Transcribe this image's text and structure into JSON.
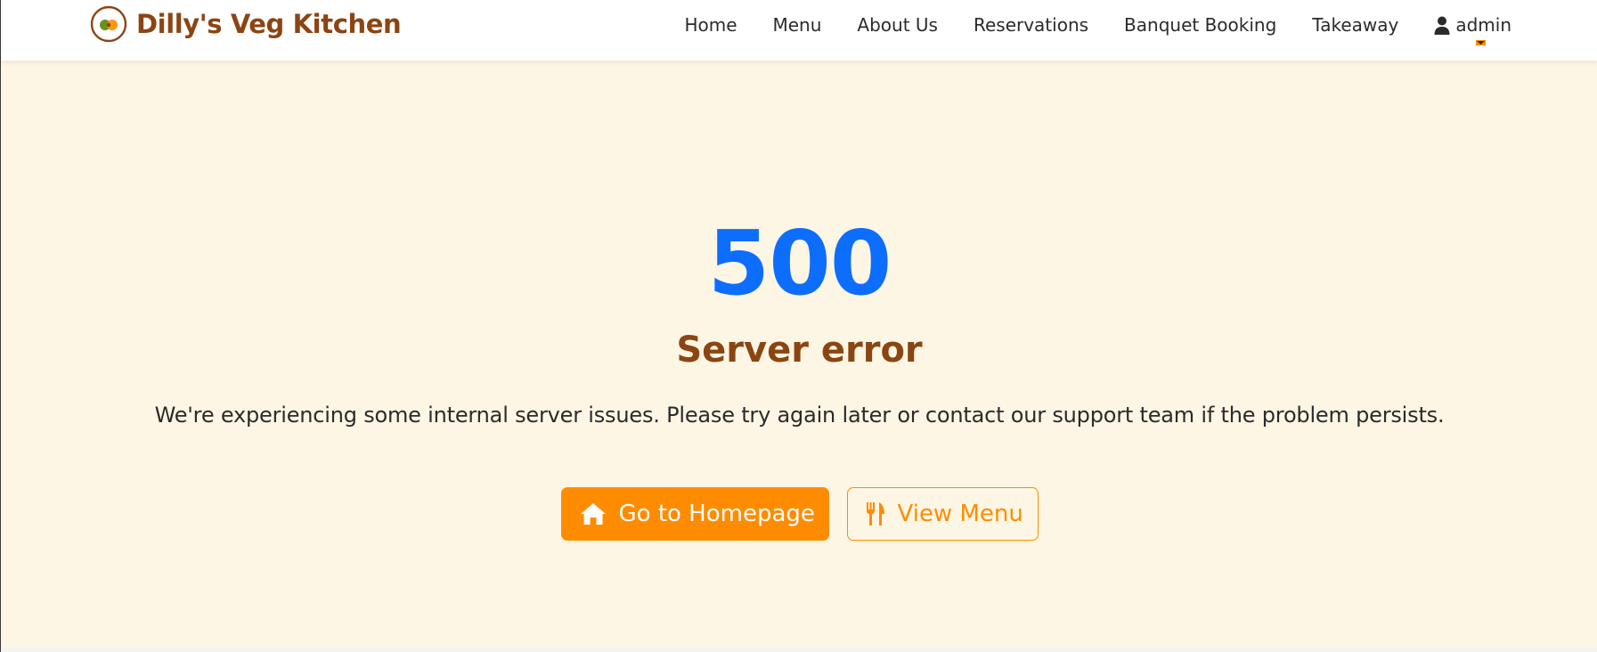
{
  "brand": {
    "name": "Dilly's Veg Kitchen",
    "logo_icon": "veg-logo-icon",
    "color": "#8b4513"
  },
  "nav": {
    "items": [
      {
        "label": "Home"
      },
      {
        "label": "Menu"
      },
      {
        "label": "About Us"
      },
      {
        "label": "Reservations"
      },
      {
        "label": "Banquet Booking"
      },
      {
        "label": "Takeaway"
      }
    ],
    "user": {
      "label": "admin",
      "icon": "user-icon"
    }
  },
  "error": {
    "code": "500",
    "title": "Server error",
    "message": "We're experiencing some internal server issues. Please try again later or contact our support team if the problem persists."
  },
  "actions": {
    "home": {
      "label": "Go to Homepage",
      "icon": "home-icon"
    },
    "menu": {
      "label": "View Menu",
      "icon": "utensils-icon"
    }
  },
  "colors": {
    "background": "#fdf6e4",
    "accent": "#ff8c00",
    "code": "#0d6efd",
    "title": "#8b4513"
  }
}
